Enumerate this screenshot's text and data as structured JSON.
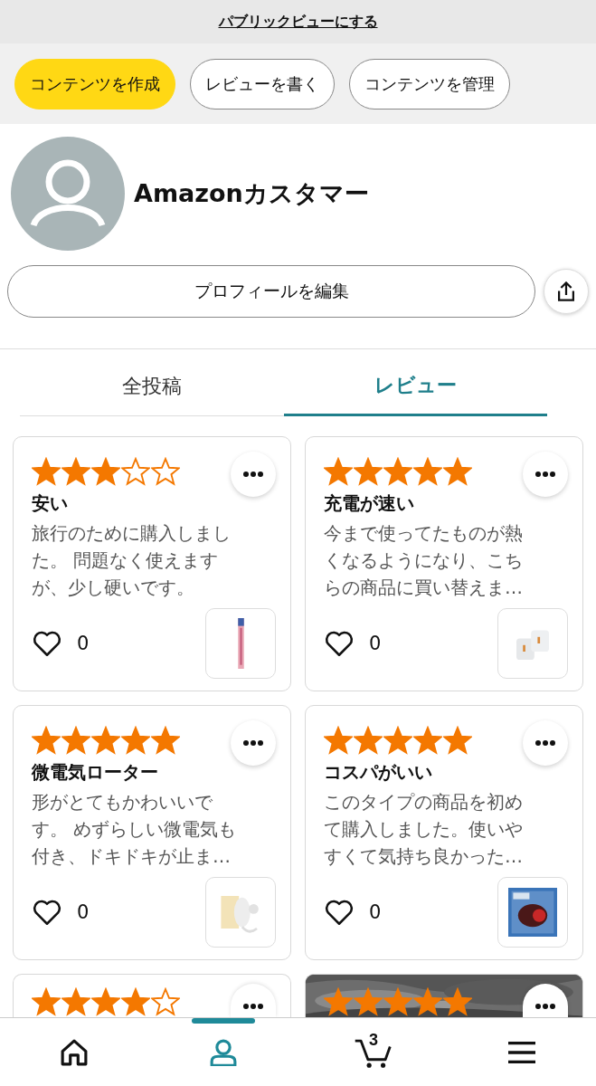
{
  "top_link": "パブリックビューにする",
  "actions": [
    {
      "label": "コンテンツを作成",
      "kind": "primary"
    },
    {
      "label": "レビューを書く",
      "kind": "secondary"
    },
    {
      "label": "コンテンツを管理",
      "kind": "secondary"
    }
  ],
  "profile": {
    "name": "Amazonカスタマー",
    "edit_button": "プロフィールを編集"
  },
  "tabs": [
    {
      "label": "全投稿",
      "selected": false
    },
    {
      "label": "レビュー",
      "selected": true
    }
  ],
  "reviews": [
    {
      "kind": "review",
      "stars": 3,
      "title": "安い",
      "body": "旅行のために購入しました。 問題なく使えますが、少し硬いです。",
      "likes": "0"
    },
    {
      "kind": "review",
      "stars": 5,
      "title": "充電が速い",
      "body": "今まで使ってたものが熱くなるようになり、こちらの商品に買い替えま…",
      "likes": "0"
    },
    {
      "kind": "review",
      "stars": 5,
      "title": "微電気ローター",
      "body": "形がとてもかわいいです。 めずらしい微電気も付き、ドキドキが止ま…",
      "likes": "0"
    },
    {
      "kind": "review",
      "stars": 5,
      "title": "コスパがいい",
      "body": "このタイプの商品を初めて購入しました。使いやすくて気持ち良かった…",
      "likes": "0"
    },
    {
      "kind": "partial",
      "stars": 4
    },
    {
      "stars": 5
    }
  ],
  "nav": [
    {
      "kind": "home",
      "selected": false
    },
    {
      "kind": "profile",
      "selected": true
    },
    {
      "kind": "cart",
      "selected": false,
      "badge": "3"
    },
    {
      "kind": "menu",
      "selected": false
    }
  ]
}
